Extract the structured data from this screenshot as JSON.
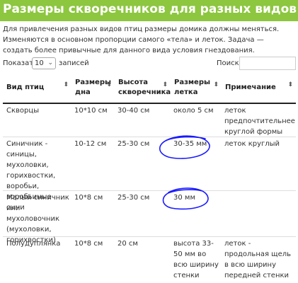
{
  "page": {
    "title": "Размеры скворечников для разных видов птиц",
    "intro": "Для привлечения разных видов птиц размеры домика должны меняться. Изменяются в основном пропорции самого «тела» и леток. Задача — создать более привычные для данного вида условия гнездования."
  },
  "controls": {
    "show_label": "Показать",
    "page_length": "10",
    "entries_label": "записей",
    "search_label": "Поиск:",
    "search_value": ""
  },
  "table": {
    "headers": [
      "Вид птиц",
      "Размеры дна",
      "Высота скворечника",
      "Размеры летка",
      "Примечание"
    ],
    "rows": [
      [
        "Скворцы",
        "10*10 см",
        "30-40 см",
        "около 5 см",
        "леток предпочтительнее круглой формы"
      ],
      [
        "Синичник - синицы, мухоловки, горихвостки, воробьи, воробьиные сычи",
        "10-12 см",
        "25-30 см",
        "30-35 мм",
        "леток круглый"
      ],
      [
        "Малый синичник или мухоловочник (мухоловки, горихвостки)",
        "10*8 см",
        "25-30 см",
        "30 мм",
        ""
      ],
      [
        "Полудуплянка",
        "10*8 см",
        "20 см",
        "высота 33-50 мм во всю ширину стенки",
        "леток - продольная щель в всю ширину передней стенки"
      ]
    ]
  },
  "colors": {
    "title_bg": "#8dc63f",
    "annotation": "#1a1aff"
  },
  "icons": {
    "sort": "sort-both-icon",
    "select": "chevron-down-icon"
  }
}
